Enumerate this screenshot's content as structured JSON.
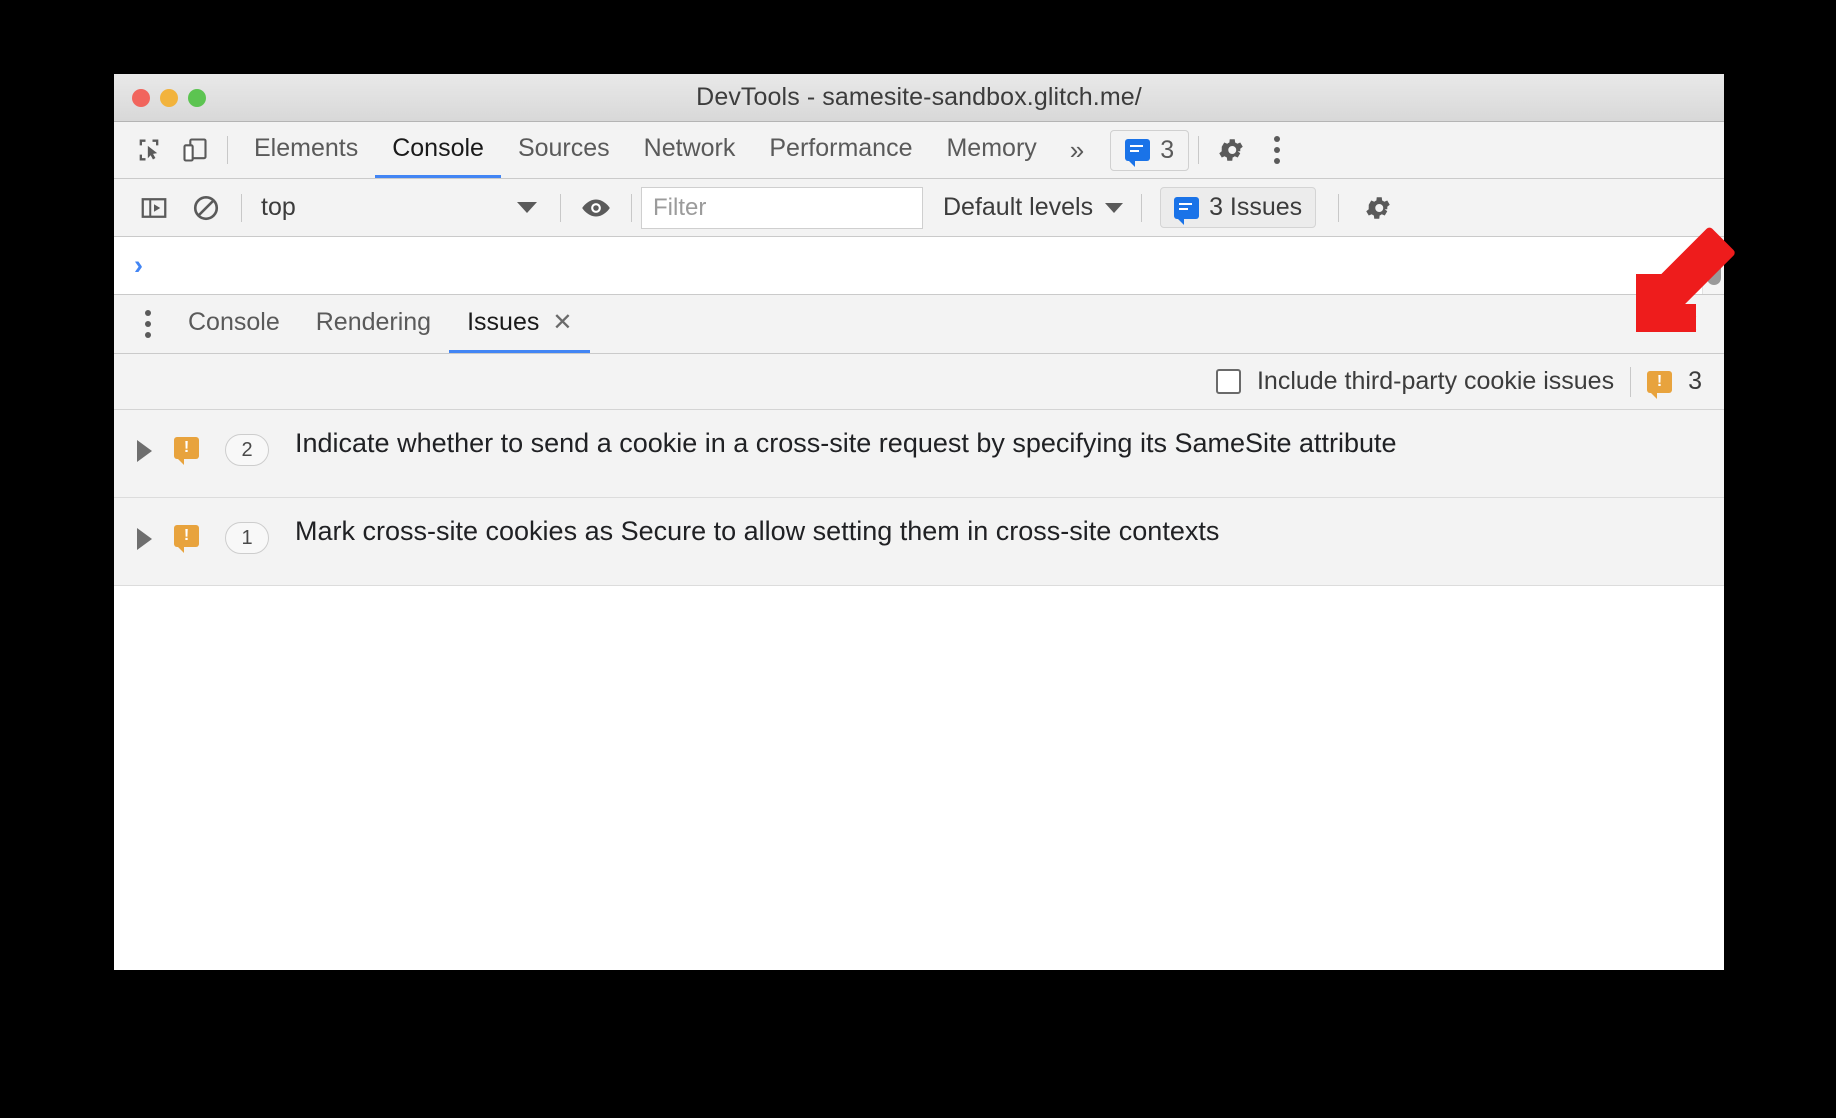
{
  "window": {
    "title": "DevTools - samesite-sandbox.glitch.me/",
    "traffic_lights": [
      "close-red",
      "minimize-yellow",
      "maximize-green"
    ]
  },
  "main_tabbar": {
    "inspect_icon": "inspect-element-icon",
    "device_icon": "device-toolbar-icon",
    "tabs": [
      {
        "label": "Elements",
        "active": false
      },
      {
        "label": "Console",
        "active": true
      },
      {
        "label": "Sources",
        "active": false
      },
      {
        "label": "Network",
        "active": false
      },
      {
        "label": "Performance",
        "active": false
      },
      {
        "label": "Memory",
        "active": false
      }
    ],
    "more_tabs_label": "»",
    "issues_badge": {
      "icon": "issue-bubble-blue-icon",
      "count": "3"
    },
    "settings_icon": "gear-icon",
    "menu_icon": "kebab-menu-icon"
  },
  "console_toolbar": {
    "sidebar_toggle_icon": "console-sidebar-icon",
    "clear_icon": "clear-console-icon",
    "context": {
      "value": "top",
      "caret": "chevron-down-icon"
    },
    "eye_icon": "live-expression-icon",
    "filter": {
      "value": "",
      "placeholder": "Filter"
    },
    "levels": {
      "value": "Default levels",
      "caret": "chevron-down-icon"
    },
    "issues_button": {
      "icon": "issue-bubble-blue-icon",
      "label": "3 Issues"
    },
    "settings_icon": "gear-icon"
  },
  "console_view": {
    "prompt": "›",
    "scrollbar": "vertical-scrollbar"
  },
  "drawer": {
    "menu_icon": "kebab-menu-icon",
    "tabs": [
      {
        "label": "Console",
        "active": false,
        "closable": false
      },
      {
        "label": "Rendering",
        "active": false,
        "closable": false
      },
      {
        "label": "Issues",
        "active": true,
        "closable": true,
        "close_glyph": "✕"
      }
    ],
    "close_glyph": "✕"
  },
  "issues_pane": {
    "third_party_checkbox": {
      "label": "Include third-party cookie issues",
      "checked": false
    },
    "total_icon": "issue-bubble-orange-icon",
    "total_count": "3",
    "rows": [
      {
        "expander": "expand-triangle-icon",
        "icon": "issue-bubble-orange-icon",
        "count": "2",
        "title": "Indicate whether to send a cookie in a cross-site request by specifying its SameSite attribute"
      },
      {
        "expander": "expand-triangle-icon",
        "icon": "issue-bubble-orange-icon",
        "count": "1",
        "title": "Mark cross-site cookies as Secure to allow setting them in cross-site contexts"
      }
    ]
  },
  "annotation": {
    "arrow": "red-arrow-pointing-down-left",
    "color": "#ee1c1c"
  },
  "colors": {
    "accent_blue": "#4285f4",
    "issue_orange": "#e8a33d",
    "issue_blue": "#1a73e8",
    "toolbar_bg": "#f3f3f3",
    "annotation_red": "#ee1c1c"
  }
}
